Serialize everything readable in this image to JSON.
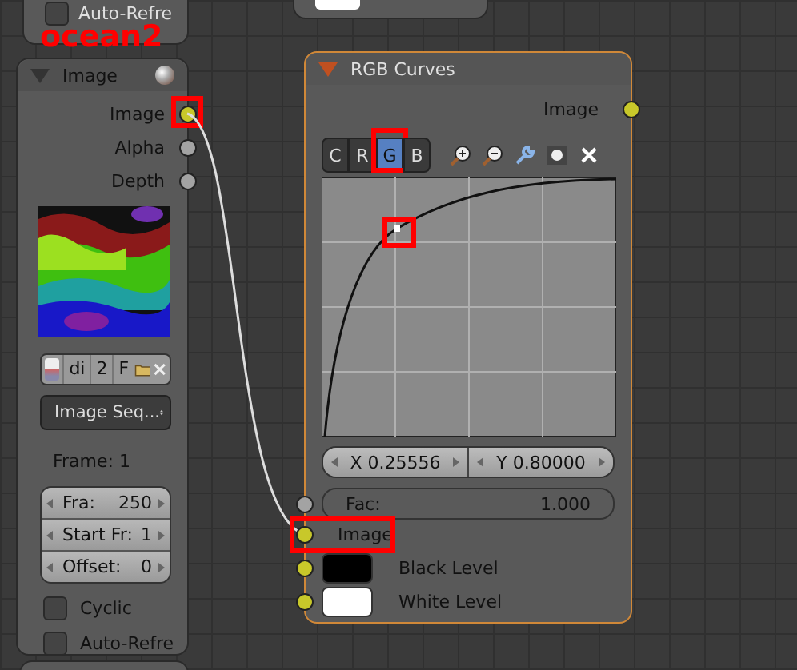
{
  "top_node": {
    "checkbox": {
      "label": "Auto-Refre",
      "checked": false
    }
  },
  "annotation": {
    "label": "ocean2"
  },
  "image_node": {
    "title": "Image",
    "expanded": true,
    "outputs": [
      {
        "label": "Image",
        "color": "#c8c82a",
        "highlighted": true
      },
      {
        "label": "Alpha",
        "color": "#a3a3a3",
        "highlighted": false
      },
      {
        "label": "Depth",
        "color": "#a3a3a3",
        "highlighted": false
      }
    ],
    "image_selector": {
      "fields": [
        "di",
        "2",
        "F"
      ]
    },
    "source": "Image Seq...",
    "frame": "Frame: 1",
    "fields": [
      {
        "label": "Fra:",
        "value": "250"
      },
      {
        "label": "Start Fr:",
        "value": "1"
      },
      {
        "label": "Offset:",
        "value": "0"
      }
    ],
    "checkboxes": [
      {
        "label": "Cyclic",
        "checked": false
      },
      {
        "label": "Auto-Refre",
        "checked": false
      }
    ]
  },
  "curves_node": {
    "title": "RGB Curves",
    "expanded": true,
    "selected": true,
    "outputs": [
      {
        "label": "Image",
        "color": "#c8c82a"
      }
    ],
    "channels": [
      {
        "label": "C",
        "selected": false,
        "highlighted": false
      },
      {
        "label": "R",
        "selected": false,
        "highlighted": false
      },
      {
        "label": "G",
        "selected": true,
        "highlighted": true
      },
      {
        "label": "B",
        "selected": false,
        "highlighted": false
      }
    ],
    "curve_point": {
      "highlighted": true
    },
    "point_x": "X 0.25556",
    "point_y": "Y 0.80000",
    "fac": {
      "label": "Fac:",
      "value": "1.000",
      "color": "#a3a3a3"
    },
    "inputs": [
      {
        "kind": "socket",
        "label": "Image",
        "highlighted": true
      },
      {
        "kind": "swatch",
        "label": "Black Level",
        "color": "#000000",
        "highlighted": false
      },
      {
        "kind": "swatch",
        "label": "White Level",
        "color": "#ffffff",
        "highlighted": false
      }
    ]
  }
}
